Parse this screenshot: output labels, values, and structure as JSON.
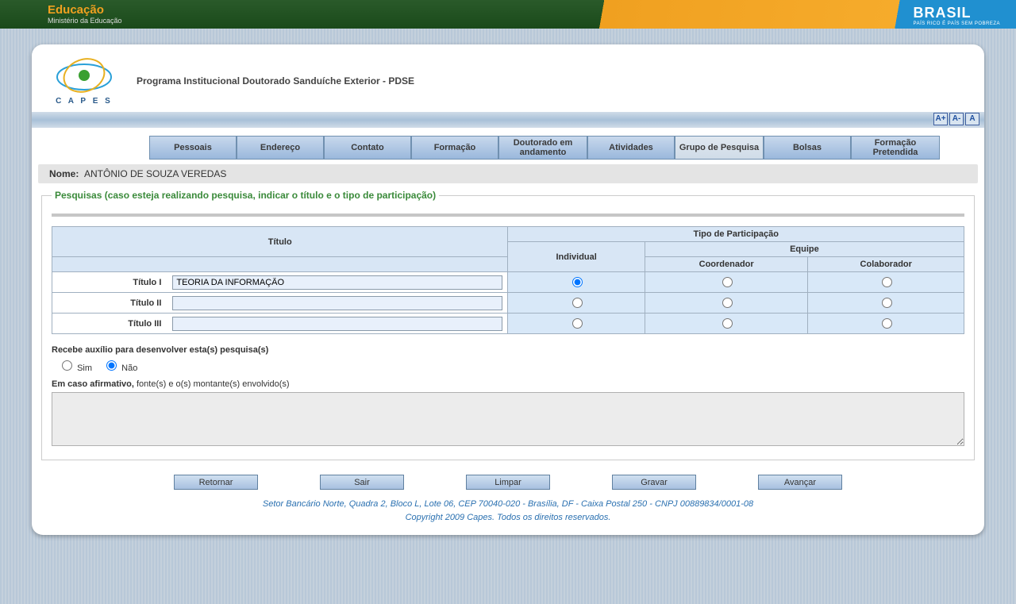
{
  "top": {
    "edu_title": "Educação",
    "edu_sub": "Ministério da Educação",
    "brasil": "BRASIL",
    "brasil_sub": "PAÍS RICO É PAÍS SEM POBREZA"
  },
  "header": {
    "logo_caption": "C A P E S",
    "program_title": "Programa Institucional Doutorado Sanduíche Exterior - PDSE"
  },
  "font_ctrls": {
    "larger": "A+",
    "smaller": "A-",
    "normal": "A"
  },
  "tabs": {
    "pessoais": "Pessoais",
    "endereco": "Endereço",
    "contato": "Contato",
    "formacao": "Formação",
    "doutorado": "Doutorado em andamento",
    "atividades": "Atividades",
    "grupo": "Grupo de Pesquisa",
    "bolsas": "Bolsas",
    "formacao_pret": "Formação Pretendida"
  },
  "name_bar": {
    "label": "Nome:",
    "value": "ANTÔNIO DE SOUZA VEREDAS"
  },
  "fieldset": {
    "legend": "Pesquisas (caso esteja realizando pesquisa, indicar o título e o tipo de participação)",
    "th_titulo": "Título",
    "th_tipo": "Tipo de Participação",
    "th_individual": "Individual",
    "th_equipe": "Equipe",
    "th_coord": "Coordenador",
    "th_colab": "Colaborador",
    "row1_label": "Título I",
    "row2_label": "Título II",
    "row3_label": "Título III",
    "row1_value": "TEORIA DA INFORMAÇÃO",
    "row2_value": "",
    "row3_value": "",
    "row1_sel": "individual",
    "row2_sel": "",
    "row3_sel": ""
  },
  "aux": {
    "question": "Recebe auxílio para desenvolver esta(s) pesquisa(s)",
    "sim": "Sim",
    "nao": "Não",
    "selected": "nao",
    "hint_bold": "Em caso afirmativo,",
    "hint_rest": " fonte(s) e o(s) montante(s) envolvido(s)",
    "text": ""
  },
  "buttons": {
    "retornar": "Retornar",
    "sair": "Sair",
    "limpar": "Limpar",
    "gravar": "Gravar",
    "avancar": "Avançar"
  },
  "footer": {
    "line1": "Setor Bancário Norte, Quadra 2, Bloco L, Lote 06, CEP 70040-020 - Brasília, DF - Caixa Postal 250 - CNPJ 00889834/0001-08",
    "line2": "Copyright 2009 Capes. Todos os direitos reservados."
  }
}
